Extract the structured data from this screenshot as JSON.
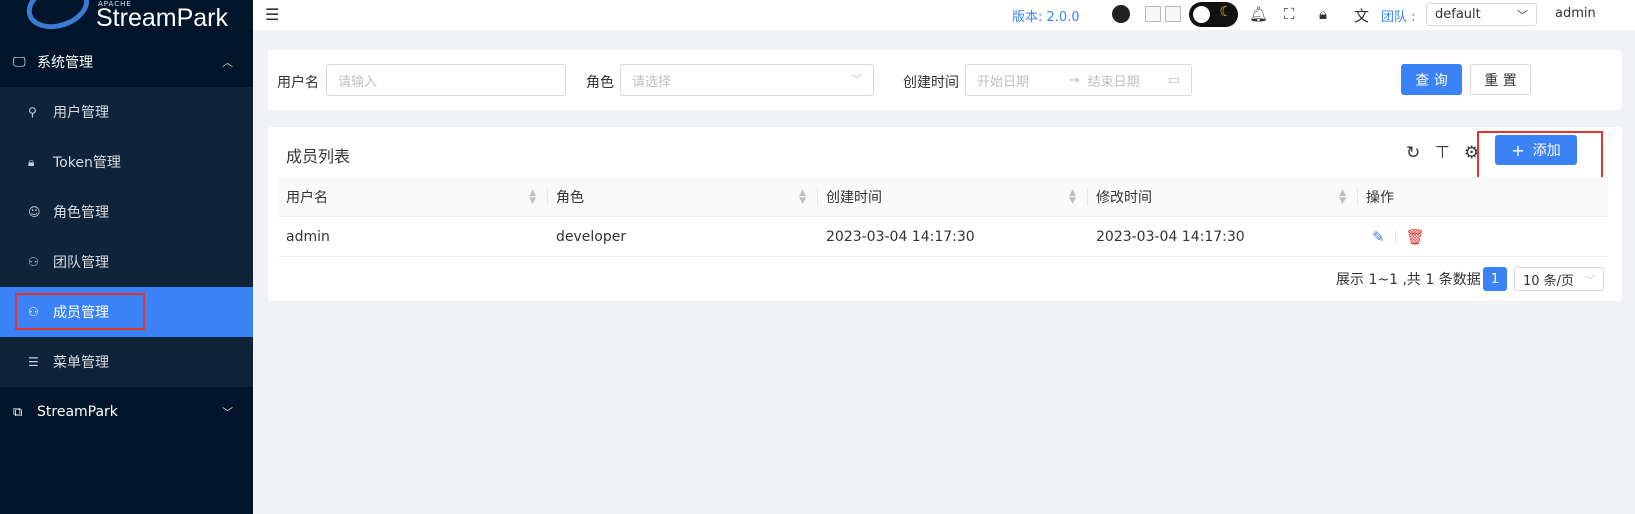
{
  "brand": {
    "apache": "APACHE",
    "name": "StreamPark"
  },
  "sidebar": {
    "group": {
      "label": "系统管理",
      "icon": "monitor-icon",
      "arrow": "chevron-up-icon"
    },
    "items": [
      {
        "label": "用户管理",
        "icon": "user-icon",
        "active": false
      },
      {
        "label": "Token管理",
        "icon": "lock-icon",
        "active": false
      },
      {
        "label": "角色管理",
        "icon": "smile-icon",
        "active": false
      },
      {
        "label": "团队管理",
        "icon": "team-icon",
        "active": false
      },
      {
        "label": "成员管理",
        "icon": "member-icon",
        "active": true
      },
      {
        "label": "菜单管理",
        "icon": "list-icon",
        "active": false
      }
    ],
    "group2": {
      "label": "StreamPark",
      "icon": "blocks-icon",
      "arrow": "chevron-down-icon"
    }
  },
  "header": {
    "version": "版本: 2.0.0",
    "team_label": "团队 :",
    "team_value": "default",
    "user": "admin"
  },
  "search": {
    "username_label": "用户名",
    "username_placeholder": "请输入",
    "role_label": "角色",
    "role_placeholder": "请选择",
    "created_label": "创建时间",
    "start_placeholder": "开始日期",
    "end_placeholder": "结束日期",
    "query_label": "查 询",
    "reset_label": "重 置"
  },
  "table": {
    "title": "成员列表",
    "add_label": "添加",
    "columns": [
      "用户名",
      "角色",
      "创建时间",
      "修改时间",
      "操作"
    ],
    "rows": [
      {
        "username": "admin",
        "role": "developer",
        "created": "2023-03-04 14:17:30",
        "modified": "2023-03-04 14:17:30"
      }
    ],
    "pager_total": "展示 1~1 ,共 1 条数据",
    "page": "1",
    "page_size": "10 条/页"
  },
  "colors": {
    "accent": "#3b82f6",
    "sidebar_bg": "#001529",
    "danger": "#e5322d"
  }
}
